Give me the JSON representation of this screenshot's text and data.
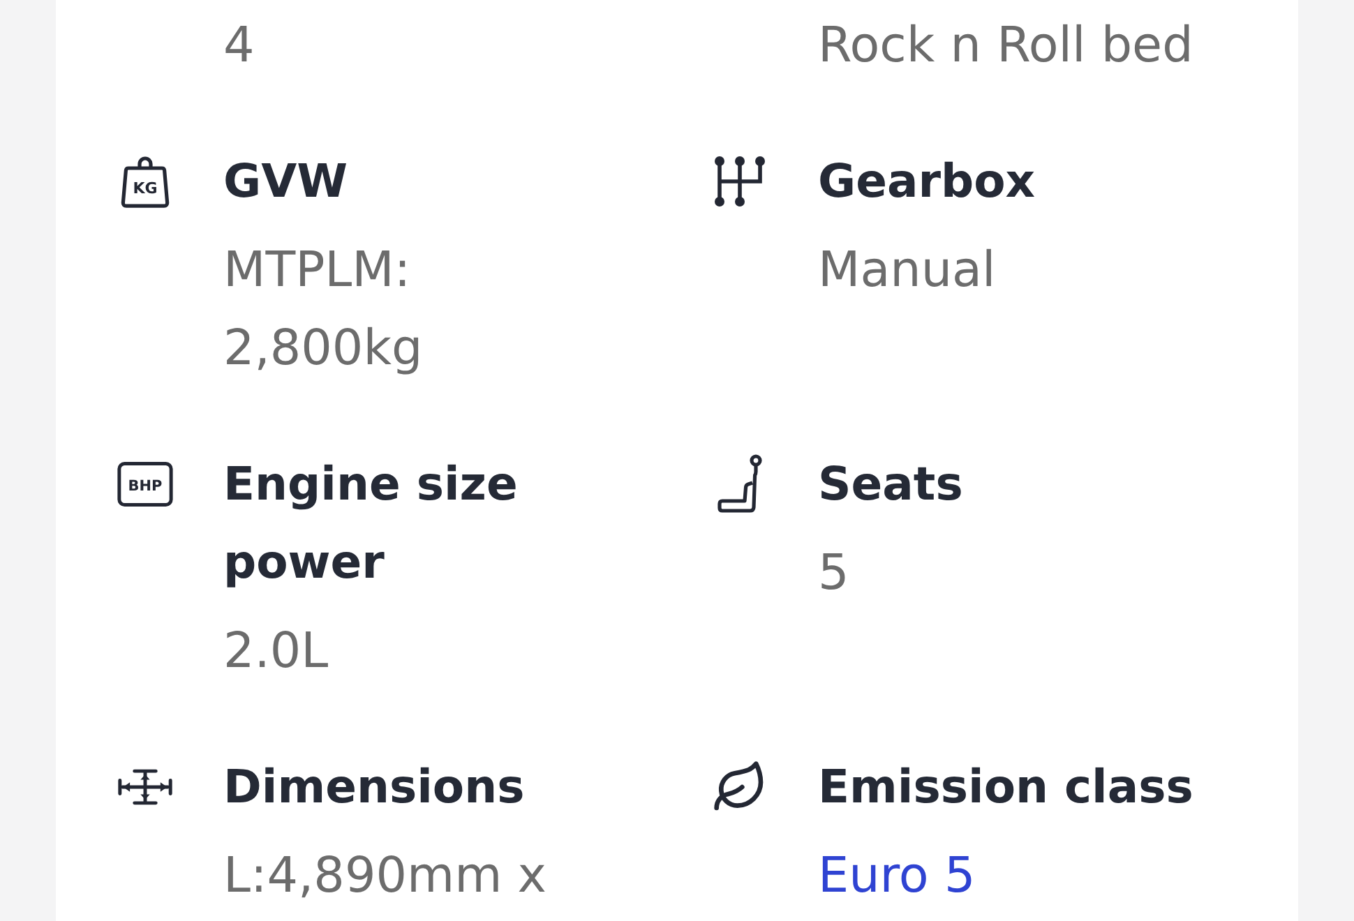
{
  "specs": [
    {
      "value": "4",
      "link": false
    },
    {
      "value": "Rock n Roll bed",
      "link": false
    },
    {
      "kind": "weight",
      "icon_label": "KG",
      "heading": "GVW",
      "value": "MTPLM: 2,800kg",
      "link": false
    },
    {
      "kind": "gearbox",
      "heading": "Gearbox",
      "value": "Manual",
      "link": false
    },
    {
      "kind": "engine",
      "icon_label": "BHP",
      "heading": "Engine size power",
      "value": "2.0L",
      "link": false
    },
    {
      "kind": "seats",
      "heading": "Seats",
      "value": "5",
      "link": false
    },
    {
      "kind": "dimensions",
      "heading": "Dimensions",
      "value": "L:4,890mm x",
      "link": false
    },
    {
      "kind": "emission",
      "heading": "Emission class",
      "value": "Euro 5",
      "link": true
    }
  ]
}
